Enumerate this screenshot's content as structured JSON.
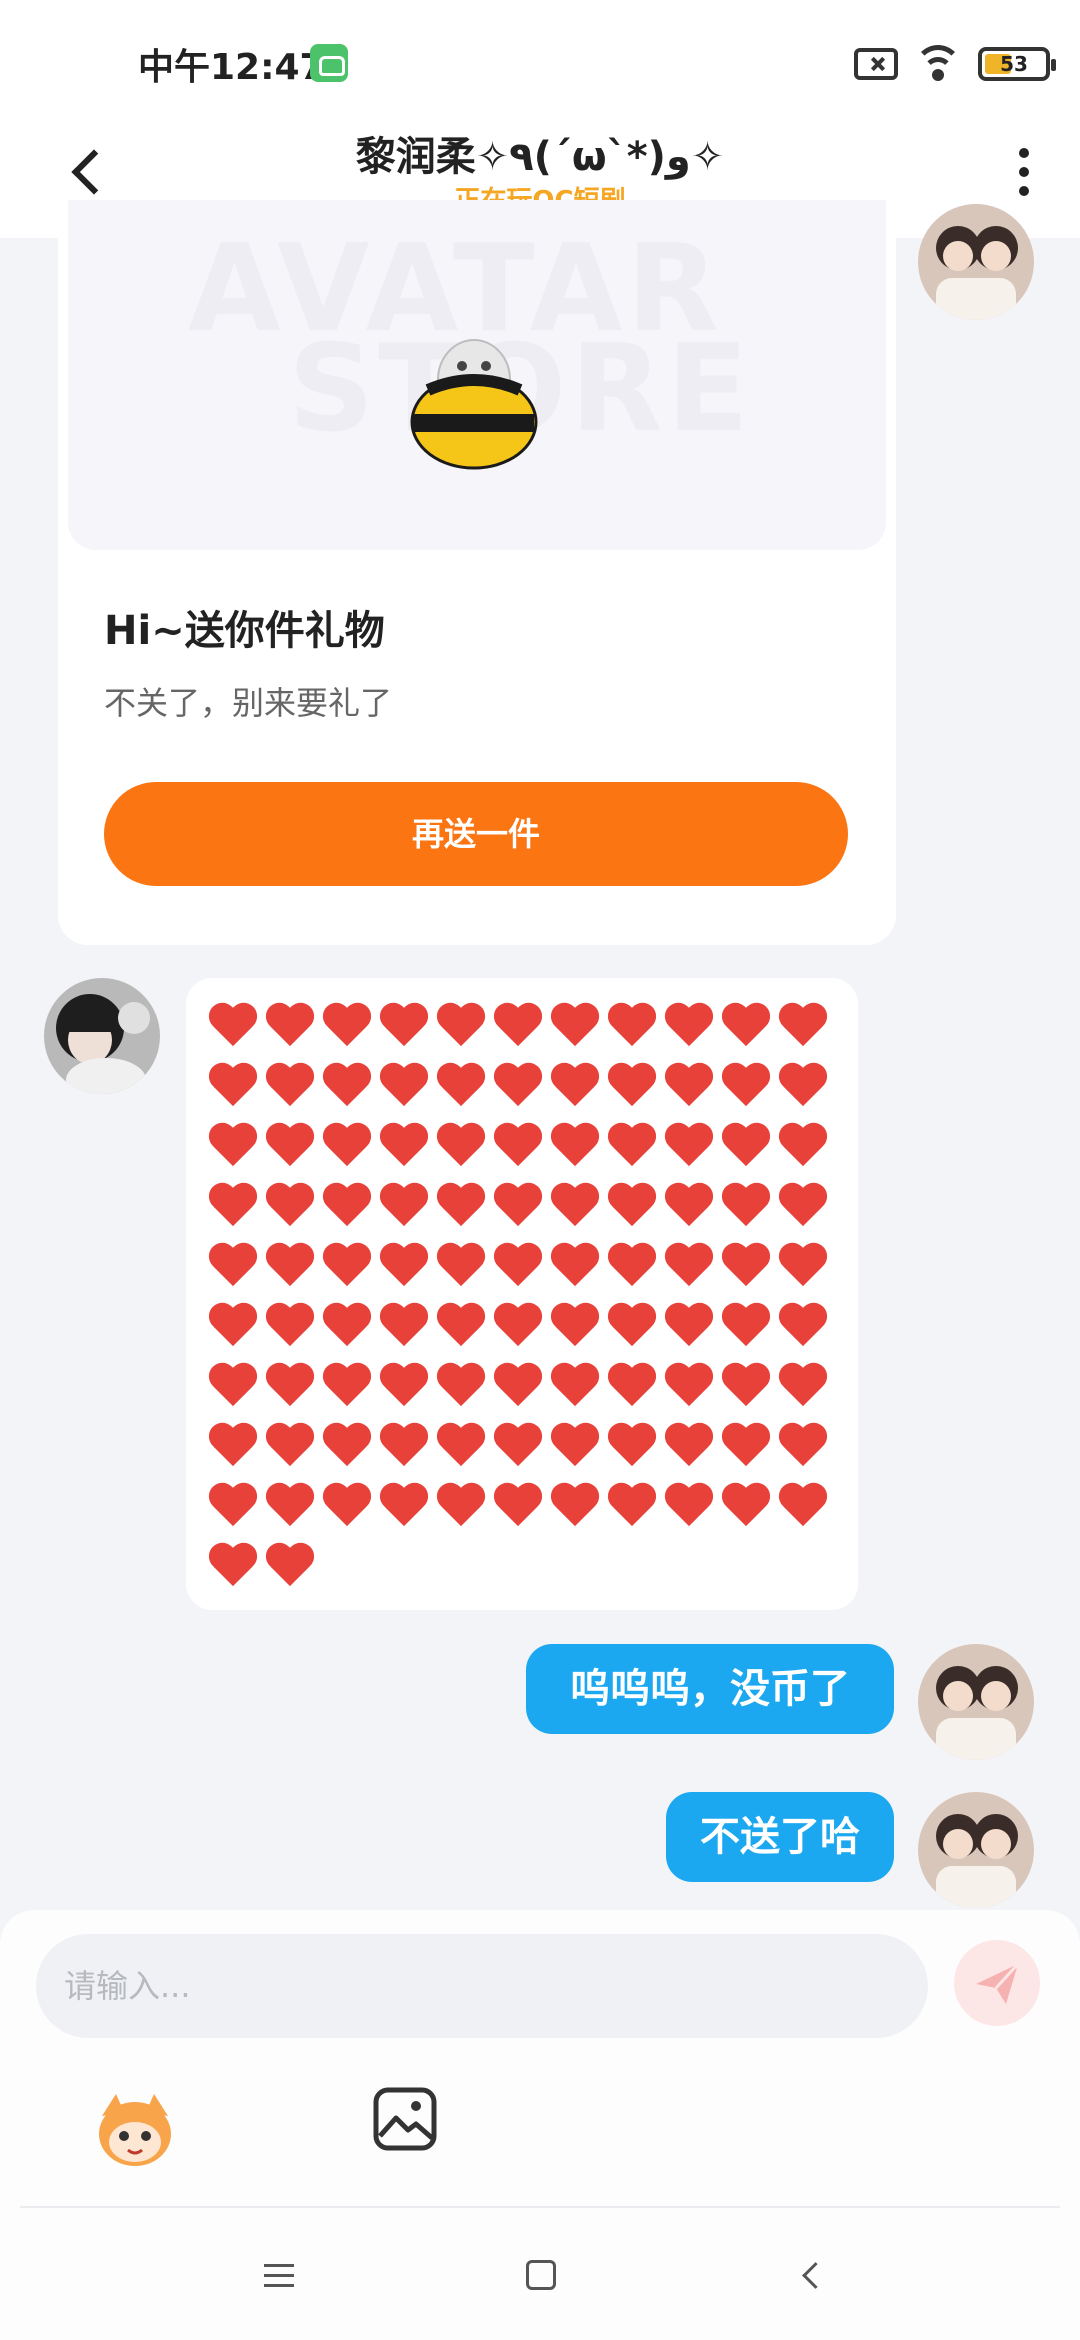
{
  "status_bar": {
    "time": "中午12:47",
    "battery": "53"
  },
  "header": {
    "title": "黎润柔✧٩(ˊωˋ*)و✧",
    "subtitle": "正在玩OC短剧"
  },
  "gift_card": {
    "image_text_line1": "AVATAR",
    "image_text_line2": "STORE",
    "title": "Hi~送你件礼物",
    "subtitle": "不关了，别来要礼了",
    "button_label": "再送一件"
  },
  "messages": {
    "heart_count": 101,
    "reply_1": "呜呜呜，没币了",
    "reply_2": "不送了哈"
  },
  "composer": {
    "placeholder": "请输入..."
  },
  "colors": {
    "accent_orange": "#fb7512",
    "bubble_blue": "#1ba8f0",
    "subtitle_orange": "#f5a623",
    "heart_red": "#e8413a"
  },
  "icons": {
    "back": "back-arrow-icon",
    "more": "more-vertical-icon",
    "send": "send-icon",
    "emoji": "emoji-character-icon",
    "image": "image-icon"
  }
}
